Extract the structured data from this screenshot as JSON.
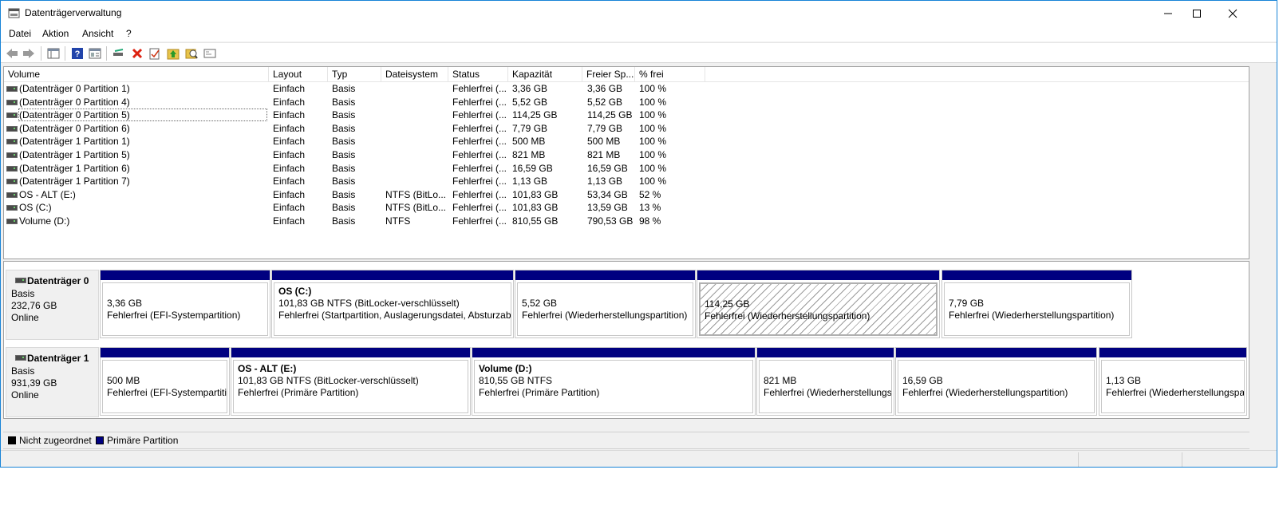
{
  "window": {
    "title": "Datenträgerverwaltung"
  },
  "menu": {
    "items": [
      "Datei",
      "Aktion",
      "Ansicht",
      "?"
    ]
  },
  "toolbar": {
    "icons": [
      "back-arrow-icon",
      "forward-arrow-icon",
      "show-hide-console-tree-icon",
      "help-icon",
      "properties-icon",
      "connect-icon",
      "delete-icon",
      "check-icon",
      "up-arrow-icon",
      "search-icon",
      "window-icon"
    ]
  },
  "volumes": {
    "columns": [
      "Volume",
      "Layout",
      "Typ",
      "Dateisystem",
      "Status",
      "Kapazität",
      "Freier Sp...",
      "% frei"
    ],
    "rows": [
      [
        "(Datenträger 0 Partition 1)",
        "Einfach",
        "Basis",
        "",
        "Fehlerfrei (...",
        "3,36 GB",
        "3,36 GB",
        "100 %"
      ],
      [
        "(Datenträger 0 Partition 4)",
        "Einfach",
        "Basis",
        "",
        "Fehlerfrei (...",
        "5,52 GB",
        "5,52 GB",
        "100 %"
      ],
      [
        "(Datenträger 0 Partition 5)",
        "Einfach",
        "Basis",
        "",
        "Fehlerfrei (...",
        "114,25 GB",
        "114,25 GB",
        "100 %"
      ],
      [
        "(Datenträger 0 Partition 6)",
        "Einfach",
        "Basis",
        "",
        "Fehlerfrei (...",
        "7,79 GB",
        "7,79 GB",
        "100 %"
      ],
      [
        "(Datenträger 1 Partition 1)",
        "Einfach",
        "Basis",
        "",
        "Fehlerfrei (...",
        "500 MB",
        "500 MB",
        "100 %"
      ],
      [
        "(Datenträger 1 Partition 5)",
        "Einfach",
        "Basis",
        "",
        "Fehlerfrei (...",
        "821 MB",
        "821 MB",
        "100 %"
      ],
      [
        "(Datenträger 1 Partition 6)",
        "Einfach",
        "Basis",
        "",
        "Fehlerfrei (...",
        "16,59 GB",
        "16,59 GB",
        "100 %"
      ],
      [
        "(Datenträger 1 Partition 7)",
        "Einfach",
        "Basis",
        "",
        "Fehlerfrei (...",
        "1,13 GB",
        "1,13 GB",
        "100 %"
      ],
      [
        "OS - ALT (E:)",
        "Einfach",
        "Basis",
        "NTFS (BitLo...",
        "Fehlerfrei (...",
        "101,83 GB",
        "53,34 GB",
        "52 %"
      ],
      [
        "OS (C:)",
        "Einfach",
        "Basis",
        "NTFS (BitLo...",
        "Fehlerfrei (...",
        "101,83 GB",
        "13,59 GB",
        "13 %"
      ],
      [
        "Volume (D:)",
        "Einfach",
        "Basis",
        "NTFS",
        "Fehlerfrei (...",
        "810,55 GB",
        "790,53 GB",
        "98 %"
      ]
    ]
  },
  "disks": [
    {
      "name": "Datenträger 0",
      "type": "Basis",
      "size": "232,76 GB",
      "status": "Online",
      "partitions": [
        {
          "title": "",
          "line1": "3,36 GB",
          "line2": "Fehlerfrei (EFI-Systempartition)"
        },
        {
          "title": "OS  (C:)",
          "line1": "101,83 GB NTFS (BitLocker-verschlüsselt)",
          "line2": "Fehlerfrei (Startpartition, Auslagerungsdatei, Absturzabb"
        },
        {
          "title": "",
          "line1": "5,52 GB",
          "line2": "Fehlerfrei (Wiederherstellungspartition)"
        },
        {
          "title": "",
          "line1": "114,25 GB",
          "line2": "Fehlerfrei (Wiederherstellungspartition)"
        },
        {
          "title": "",
          "line1": "7,79 GB",
          "line2": "Fehlerfrei (Wiederherstellungspartition)"
        }
      ]
    },
    {
      "name": "Datenträger 1",
      "type": "Basis",
      "size": "931,39 GB",
      "status": "Online",
      "partitions": [
        {
          "title": "",
          "line1": "500 MB",
          "line2": "Fehlerfrei (EFI-Systempartitic"
        },
        {
          "title": "OS - ALT  (E:)",
          "line1": "101,83 GB NTFS (BitLocker-verschlüsselt)",
          "line2": "Fehlerfrei (Primäre Partition)"
        },
        {
          "title": "Volume  (D:)",
          "line1": "810,55 GB NTFS",
          "line2": "Fehlerfrei (Primäre Partition)"
        },
        {
          "title": "",
          "line1": "821 MB",
          "line2": "Fehlerfrei (Wiederherstellungsp"
        },
        {
          "title": "",
          "line1": "16,59 GB",
          "line2": "Fehlerfrei (Wiederherstellungspartition)"
        },
        {
          "title": "",
          "line1": "1,13 GB",
          "line2": "Fehlerfrei (Wiederherstellungspart"
        }
      ]
    }
  ],
  "legend": {
    "items": [
      {
        "label": "Nicht zugeordnet",
        "color": "#000000"
      },
      {
        "label": "Primäre Partition",
        "color": "#000080"
      }
    ]
  },
  "colors": {
    "partition_bar": "#000080",
    "titlebar_border": "#1883d7"
  }
}
